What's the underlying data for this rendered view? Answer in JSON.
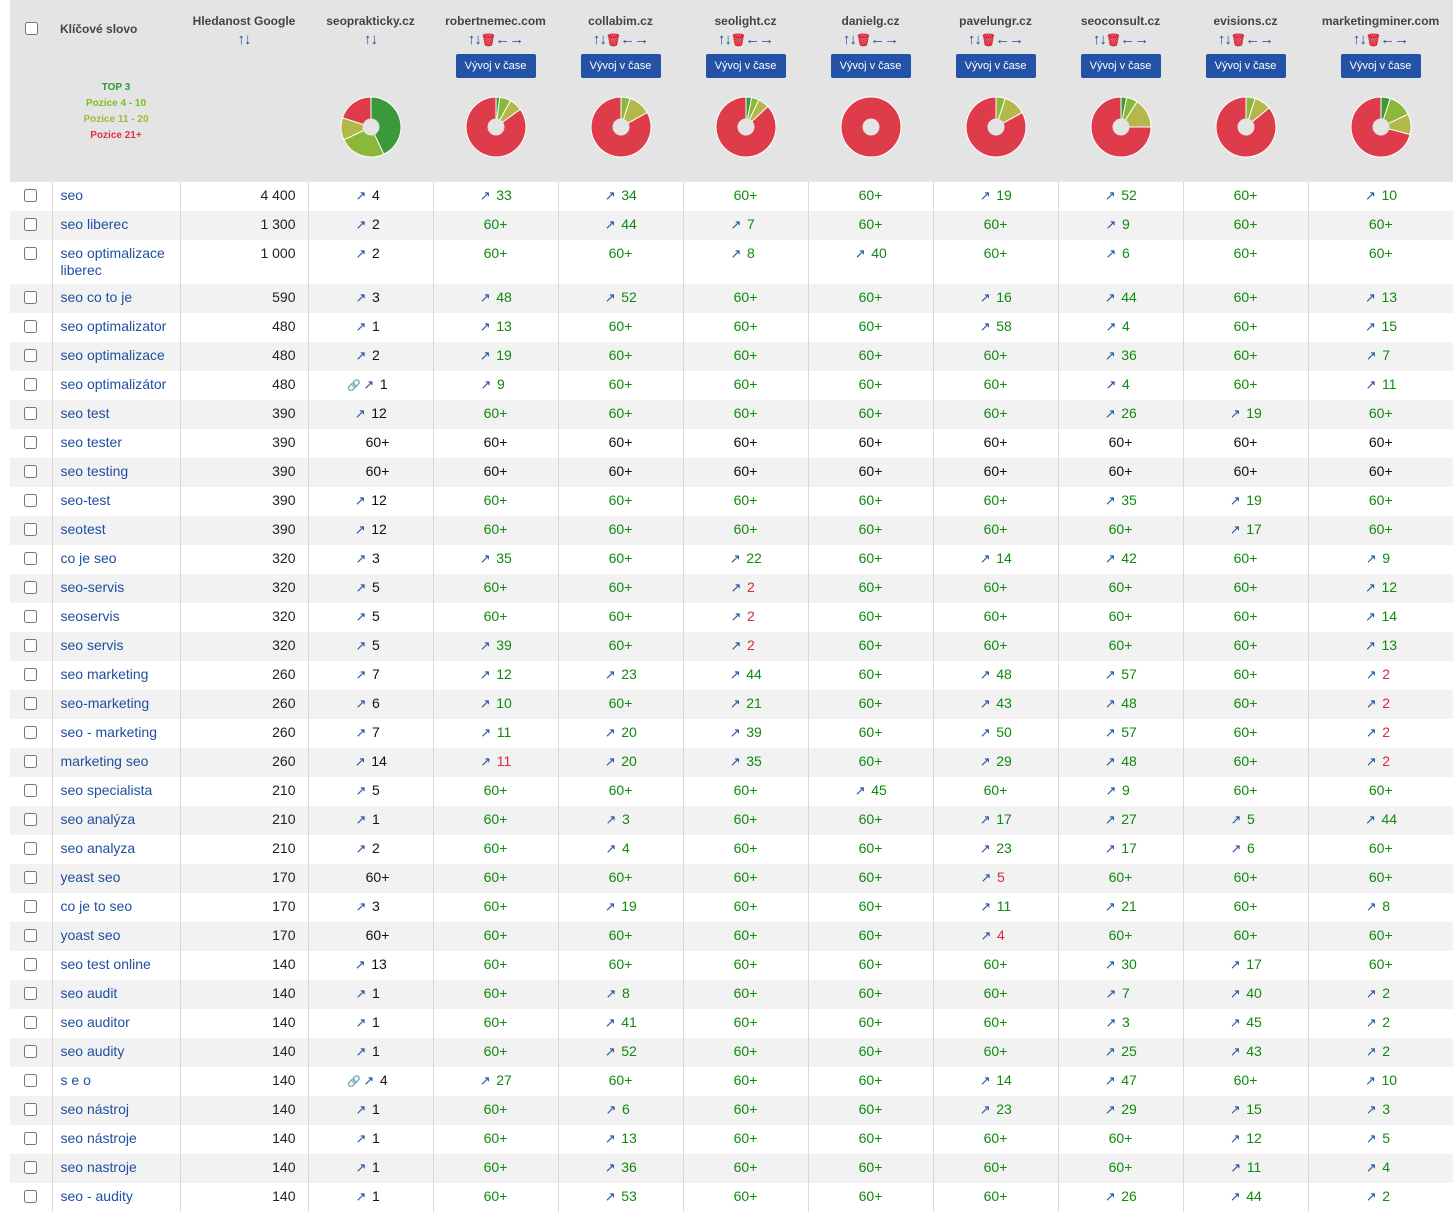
{
  "header": {
    "keyword_label": "Klíčové slovo",
    "volume_label": "Hledanost Google",
    "sort_up": "↑",
    "sort_down": "↓",
    "delete_icon": "🗑",
    "move_left": "←",
    "move_right": "→",
    "timeline_button": "Vývoj v čase"
  },
  "legend": [
    {
      "label": "TOP 3",
      "color": "#2f9b2f"
    },
    {
      "label": "Pozice 4 - 10",
      "color": "#7cc01f"
    },
    {
      "label": "Pozice 11 - 20",
      "color": "#a8b63a"
    },
    {
      "label": "Pozice 21+",
      "color": "#e0303f"
    }
  ],
  "colors": {
    "top3": "#3a9a3a",
    "p4_10": "#8ab93a",
    "p11_20": "#b3b84a",
    "p21": "#de3b4b",
    "none": "#de3b4b"
  },
  "domains": [
    {
      "name": "seoprakticky.cz",
      "mine": true,
      "pie": [
        0.43,
        0.25,
        0.12,
        0.2
      ]
    },
    {
      "name": "robertnemec.com",
      "pie": [
        0.02,
        0.06,
        0.07,
        0.85
      ]
    },
    {
      "name": "collabim.cz",
      "pie": [
        0.0,
        0.05,
        0.12,
        0.83
      ]
    },
    {
      "name": "seolight.cz",
      "pie": [
        0.03,
        0.04,
        0.06,
        0.87
      ]
    },
    {
      "name": "danielg.cz",
      "pie": [
        0.0,
        0.0,
        0.0,
        1.0
      ]
    },
    {
      "name": "pavelungr.cz",
      "pie": [
        0.0,
        0.05,
        0.12,
        0.83
      ]
    },
    {
      "name": "seoconsult.cz",
      "pie": [
        0.03,
        0.06,
        0.16,
        0.75
      ]
    },
    {
      "name": "evisions.cz",
      "pie": [
        0.0,
        0.05,
        0.09,
        0.86
      ]
    },
    {
      "name": "marketingminer.com",
      "pie": [
        0.05,
        0.13,
        0.11,
        0.71
      ]
    }
  ],
  "rows": [
    {
      "kw": "seo",
      "vol": "4 400",
      "pos": [
        "4",
        "33",
        "34",
        "60+",
        "60+",
        "19",
        "52",
        "60+",
        "10"
      ]
    },
    {
      "kw": "seo liberec",
      "vol": "1 300",
      "pos": [
        "2",
        "60+",
        "44",
        "7",
        "60+",
        "60+",
        "9",
        "60+",
        "60+"
      ]
    },
    {
      "kw": "seo optimalizace liberec",
      "vol": "1 000",
      "pos": [
        "2",
        "60+",
        "60+",
        "8",
        "40",
        "60+",
        "6",
        "60+",
        "60+"
      ]
    },
    {
      "kw": "seo co to je",
      "vol": "590",
      "pos": [
        "3",
        "48",
        "52",
        "60+",
        "60+",
        "16",
        "44",
        "60+",
        "13"
      ]
    },
    {
      "kw": "seo optimalizator",
      "vol": "480",
      "pos": [
        "1",
        "13",
        "60+",
        "60+",
        "60+",
        "58",
        "4",
        "60+",
        "15"
      ]
    },
    {
      "kw": "seo optimalizace",
      "vol": "480",
      "pos": [
        "2",
        "19",
        "60+",
        "60+",
        "60+",
        "60+",
        "36",
        "60+",
        "7"
      ]
    },
    {
      "kw": "seo optimalizátor",
      "vol": "480",
      "link": true,
      "pos": [
        "1",
        "9",
        "60+",
        "60+",
        "60+",
        "60+",
        "4",
        "60+",
        "11"
      ]
    },
    {
      "kw": "seo test",
      "vol": "390",
      "pos": [
        "12",
        "60+",
        "60+",
        "60+",
        "60+",
        "60+",
        "26",
        "19",
        "60+"
      ]
    },
    {
      "kw": "seo tester",
      "vol": "390",
      "pos": [
        "60+",
        "60+",
        "60+",
        "60+",
        "60+",
        "60+",
        "60+",
        "60+",
        "60+"
      ]
    },
    {
      "kw": "seo testing",
      "vol": "390",
      "pos": [
        "60+",
        "60+",
        "60+",
        "60+",
        "60+",
        "60+",
        "60+",
        "60+",
        "60+"
      ]
    },
    {
      "kw": "seo-test",
      "vol": "390",
      "pos": [
        "12",
        "60+",
        "60+",
        "60+",
        "60+",
        "60+",
        "35",
        "19",
        "60+"
      ]
    },
    {
      "kw": "seotest",
      "vol": "390",
      "pos": [
        "12",
        "60+",
        "60+",
        "60+",
        "60+",
        "60+",
        "60+",
        "17",
        "60+"
      ]
    },
    {
      "kw": "co je seo",
      "vol": "320",
      "pos": [
        "3",
        "35",
        "60+",
        "22",
        "60+",
        "14",
        "42",
        "60+",
        "9"
      ]
    },
    {
      "kw": "seo-servis",
      "vol": "320",
      "pos": [
        "5",
        "60+",
        "60+",
        "2",
        "60+",
        "60+",
        "60+",
        "60+",
        "12"
      ]
    },
    {
      "kw": "seoservis",
      "vol": "320",
      "pos": [
        "5",
        "60+",
        "60+",
        "2",
        "60+",
        "60+",
        "60+",
        "60+",
        "14"
      ]
    },
    {
      "kw": "seo servis",
      "vol": "320",
      "pos": [
        "5",
        "39",
        "60+",
        "2",
        "60+",
        "60+",
        "60+",
        "60+",
        "13"
      ]
    },
    {
      "kw": "seo marketing",
      "vol": "260",
      "pos": [
        "7",
        "12",
        "23",
        "44",
        "60+",
        "48",
        "57",
        "60+",
        "2"
      ]
    },
    {
      "kw": "seo-marketing",
      "vol": "260",
      "pos": [
        "6",
        "10",
        "60+",
        "21",
        "60+",
        "43",
        "48",
        "60+",
        "2"
      ]
    },
    {
      "kw": "seo - marketing",
      "vol": "260",
      "pos": [
        "7",
        "11",
        "20",
        "39",
        "60+",
        "50",
        "57",
        "60+",
        "2"
      ]
    },
    {
      "kw": "marketing seo",
      "vol": "260",
      "pos": [
        "14",
        "11",
        "20",
        "35",
        "60+",
        "29",
        "48",
        "60+",
        "2"
      ]
    },
    {
      "kw": "seo specialista",
      "vol": "210",
      "pos": [
        "5",
        "60+",
        "60+",
        "60+",
        "45",
        "60+",
        "9",
        "60+",
        "60+"
      ]
    },
    {
      "kw": "seo analýza",
      "vol": "210",
      "pos": [
        "1",
        "60+",
        "3",
        "60+",
        "60+",
        "17",
        "27",
        "5",
        "44"
      ]
    },
    {
      "kw": "seo analyza",
      "vol": "210",
      "pos": [
        "2",
        "60+",
        "4",
        "60+",
        "60+",
        "23",
        "17",
        "6",
        "60+"
      ]
    },
    {
      "kw": "yeast seo",
      "vol": "170",
      "pos": [
        "60+",
        "60+",
        "60+",
        "60+",
        "60+",
        "5",
        "60+",
        "60+",
        "60+"
      ]
    },
    {
      "kw": "co je to seo",
      "vol": "170",
      "pos": [
        "3",
        "60+",
        "19",
        "60+",
        "60+",
        "11",
        "21",
        "60+",
        "8"
      ]
    },
    {
      "kw": "yoast seo",
      "vol": "170",
      "pos": [
        "60+",
        "60+",
        "60+",
        "60+",
        "60+",
        "4",
        "60+",
        "60+",
        "60+"
      ]
    },
    {
      "kw": "seo test online",
      "vol": "140",
      "pos": [
        "13",
        "60+",
        "60+",
        "60+",
        "60+",
        "60+",
        "30",
        "17",
        "60+"
      ]
    },
    {
      "kw": "seo audit",
      "vol": "140",
      "pos": [
        "1",
        "60+",
        "8",
        "60+",
        "60+",
        "60+",
        "7",
        "40",
        "2"
      ]
    },
    {
      "kw": "seo auditor",
      "vol": "140",
      "pos": [
        "1",
        "60+",
        "41",
        "60+",
        "60+",
        "60+",
        "3",
        "45",
        "2"
      ]
    },
    {
      "kw": "seo audity",
      "vol": "140",
      "pos": [
        "1",
        "60+",
        "52",
        "60+",
        "60+",
        "60+",
        "25",
        "43",
        "2"
      ]
    },
    {
      "kw": "s e o",
      "vol": "140",
      "link": true,
      "pos": [
        "4",
        "27",
        "60+",
        "60+",
        "60+",
        "14",
        "47",
        "60+",
        "10"
      ]
    },
    {
      "kw": "seo nástroj",
      "vol": "140",
      "pos": [
        "1",
        "60+",
        "6",
        "60+",
        "60+",
        "23",
        "29",
        "15",
        "3"
      ]
    },
    {
      "kw": "seo nástroje",
      "vol": "140",
      "pos": [
        "1",
        "60+",
        "13",
        "60+",
        "60+",
        "60+",
        "60+",
        "12",
        "5"
      ]
    },
    {
      "kw": "seo nastroje",
      "vol": "140",
      "pos": [
        "1",
        "60+",
        "36",
        "60+",
        "60+",
        "60+",
        "60+",
        "11",
        "4"
      ]
    },
    {
      "kw": "seo - audity",
      "vol": "140",
      "pos": [
        "1",
        "60+",
        "53",
        "60+",
        "60+",
        "60+",
        "26",
        "44",
        "2"
      ]
    }
  ]
}
